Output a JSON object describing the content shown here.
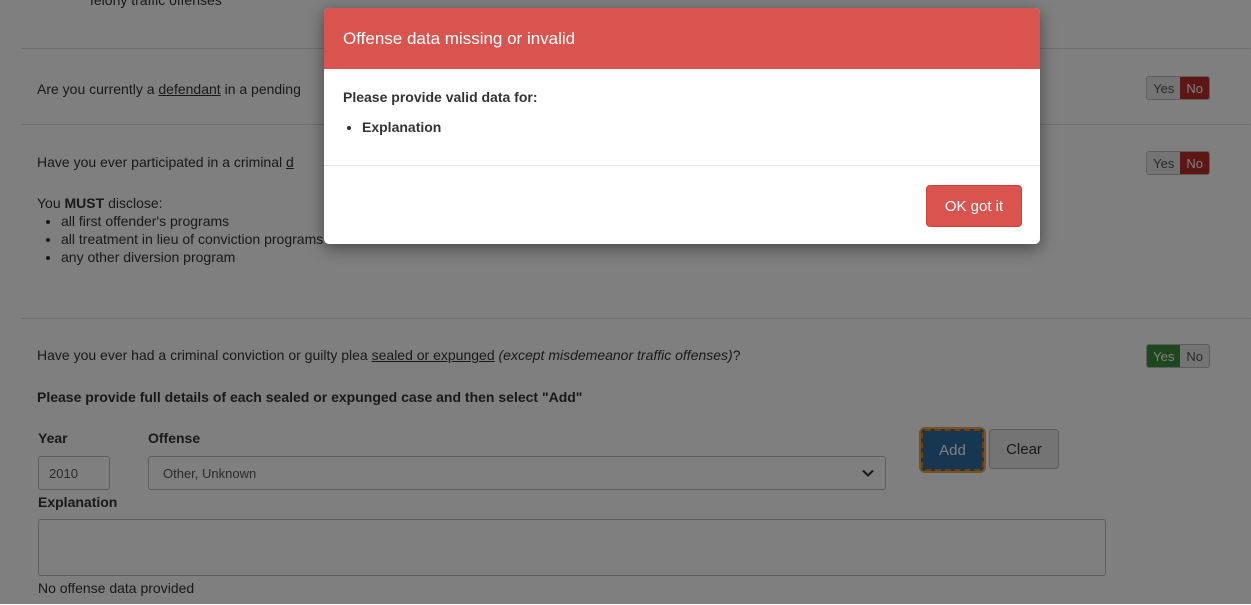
{
  "top_snippet": "felony traffic offenses",
  "questions": [
    {
      "text_before": "Are you currently a ",
      "link": "defendant",
      "text_after": " in a pending",
      "yes": "Yes",
      "no": "No",
      "selected": "No"
    },
    {
      "text_before": "Have you ever participated in a criminal ",
      "link": "d",
      "text_after": "",
      "yes": "Yes",
      "no": "No",
      "selected": "No"
    },
    {
      "text_before": "Have you ever had a criminal conviction or guilty plea ",
      "link": "sealed or expunged",
      "italic": "(except misdemeanor traffic offenses)",
      "text_after": "?",
      "yes": "Yes",
      "no": "No",
      "selected": "Yes"
    }
  ],
  "disclose": {
    "prefix": "You ",
    "must": "MUST",
    "suffix": " disclose:",
    "items": [
      "all first offender's programs",
      "all treatment in lieu of conviction programs",
      "any other diversion program"
    ]
  },
  "sealed_section": {
    "instruction": "Please provide full details of each sealed or expunged case and then select \"Add\"",
    "year_label": "Year",
    "offense_label": "Offense",
    "year_value": "2010",
    "offense_value": "Other, Unknown",
    "add_label": "Add",
    "clear_label": "Clear",
    "explanation_label": "Explanation",
    "no_data": "No offense data provided"
  },
  "modal": {
    "title": "Offense data missing or invalid",
    "message": "Please provide valid data for:",
    "fields": [
      "Explanation"
    ],
    "ok_label": "OK got it"
  },
  "colors": {
    "danger": "#d9534f",
    "primary": "#2e6da4",
    "success": "#3e8f3e",
    "no_active": "#b92c28"
  }
}
